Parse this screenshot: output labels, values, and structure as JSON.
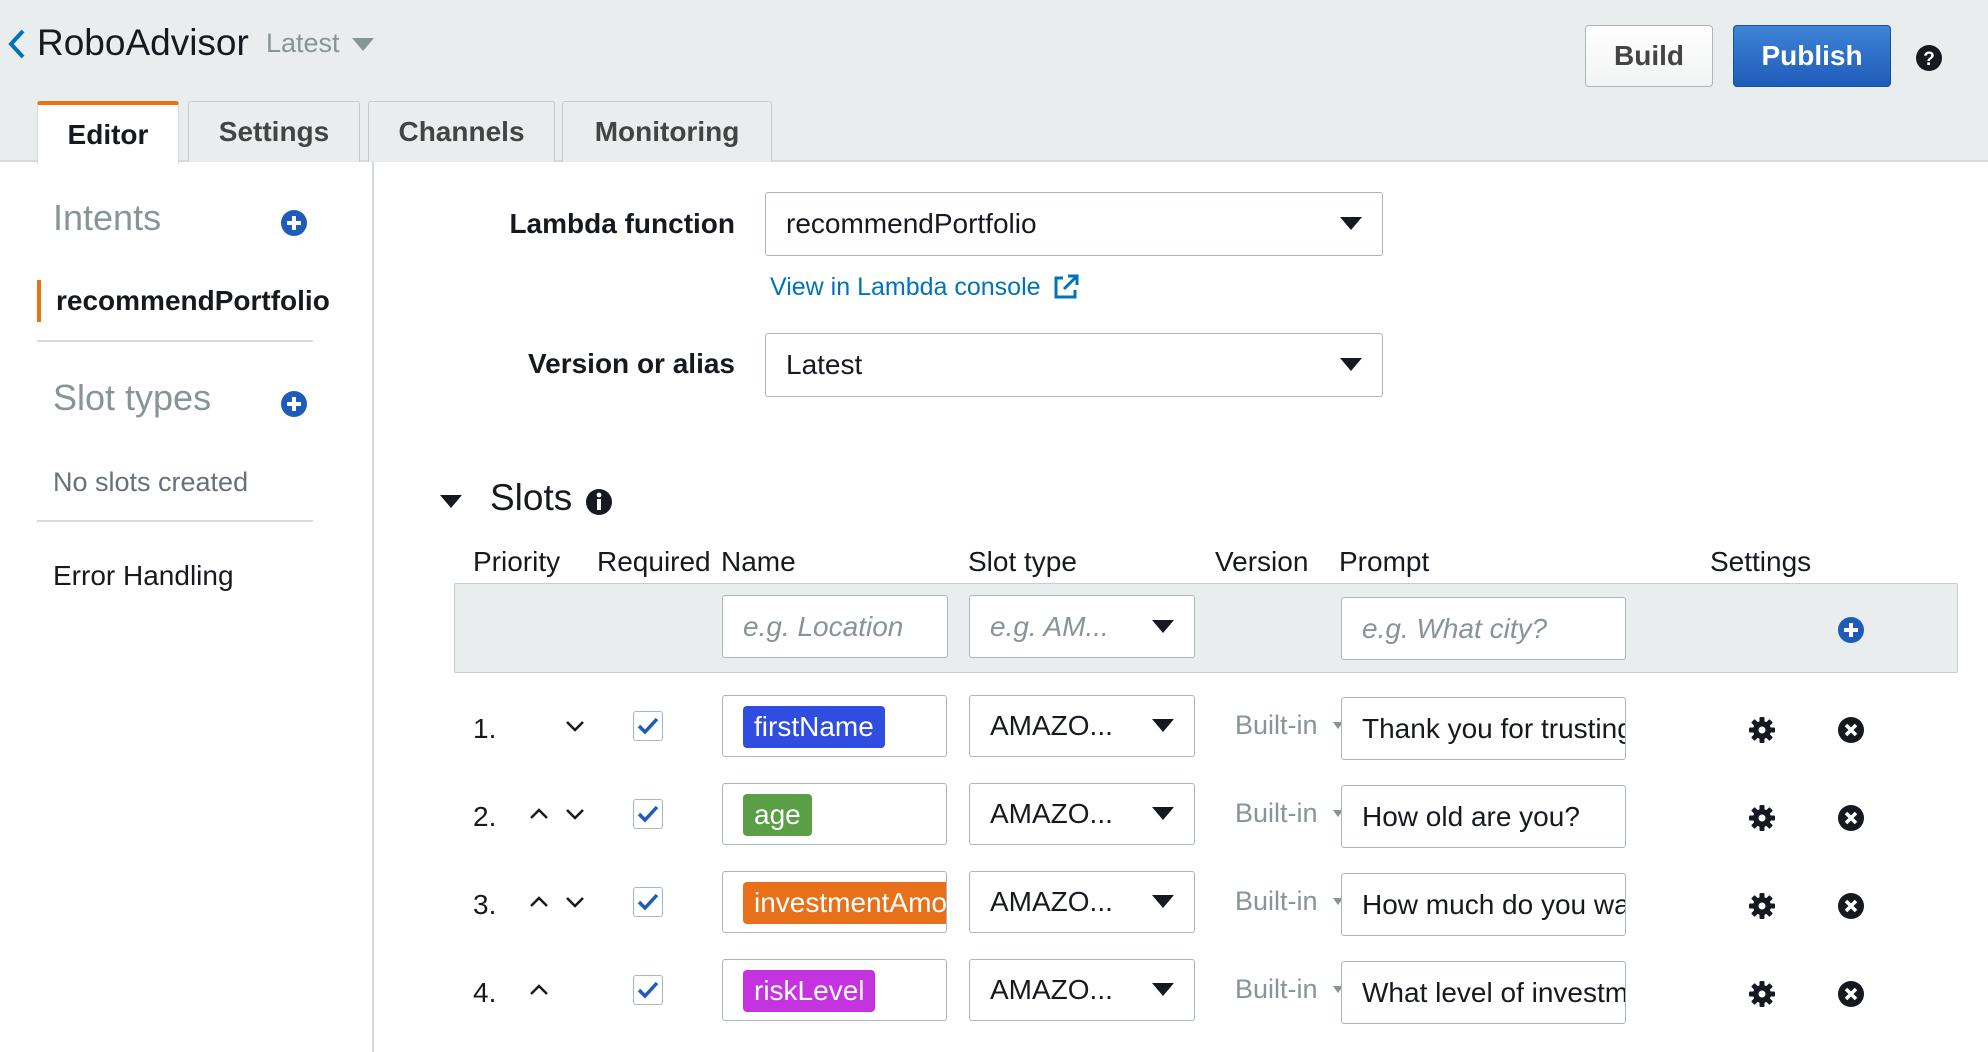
{
  "header": {
    "bot_name": "RoboAdvisor",
    "version": "Latest",
    "build_label": "Build",
    "publish_label": "Publish"
  },
  "tabs": [
    {
      "label": "Editor",
      "active": true
    },
    {
      "label": "Settings",
      "active": false
    },
    {
      "label": "Channels",
      "active": false
    },
    {
      "label": "Monitoring",
      "active": false
    }
  ],
  "sidebar": {
    "intents_heading": "Intents",
    "intents": [
      "recommendPortfolio"
    ],
    "slot_types_heading": "Slot types",
    "slot_types_empty": "No slots created",
    "error_handling": "Error Handling"
  },
  "lambda": {
    "function_label": "Lambda function",
    "function_value": "recommendPortfolio",
    "console_link": "View in Lambda console",
    "version_label": "Version or alias",
    "version_value": "Latest"
  },
  "slots": {
    "title": "Slots",
    "columns": {
      "priority": "Priority",
      "required": "Required",
      "name": "Name",
      "slot_type": "Slot type",
      "version": "Version",
      "prompt": "Prompt",
      "settings": "Settings"
    },
    "new_slot": {
      "name_placeholder": "e.g. Location",
      "type_placeholder": "e.g. AM...",
      "prompt_placeholder": "e.g. What city?"
    },
    "rows": [
      {
        "index": "1.",
        "up": false,
        "down": true,
        "required": true,
        "name": "firstName",
        "color": "#2f4de0",
        "slot_type": "AMAZO...",
        "version": "Built-in",
        "prompt": "Thank you for trusting"
      },
      {
        "index": "2.",
        "up": true,
        "down": true,
        "required": true,
        "name": "age",
        "color": "#5a9e46",
        "slot_type": "AMAZO...",
        "version": "Built-in",
        "prompt": "How old are you?"
      },
      {
        "index": "3.",
        "up": true,
        "down": true,
        "required": true,
        "name": "investmentAmount",
        "color": "#e8701a",
        "slot_type": "AMAZO...",
        "version": "Built-in",
        "prompt": "How much do you want"
      },
      {
        "index": "4.",
        "up": true,
        "down": false,
        "required": true,
        "name": "riskLevel",
        "color": "#c533e0",
        "slot_type": "AMAZO...",
        "version": "Built-in",
        "prompt": "What level of investment"
      }
    ]
  },
  "colors": {
    "accent_orange": "#ec7211",
    "primary_blue": "#1f5bb9",
    "link_blue": "#0073bb"
  }
}
